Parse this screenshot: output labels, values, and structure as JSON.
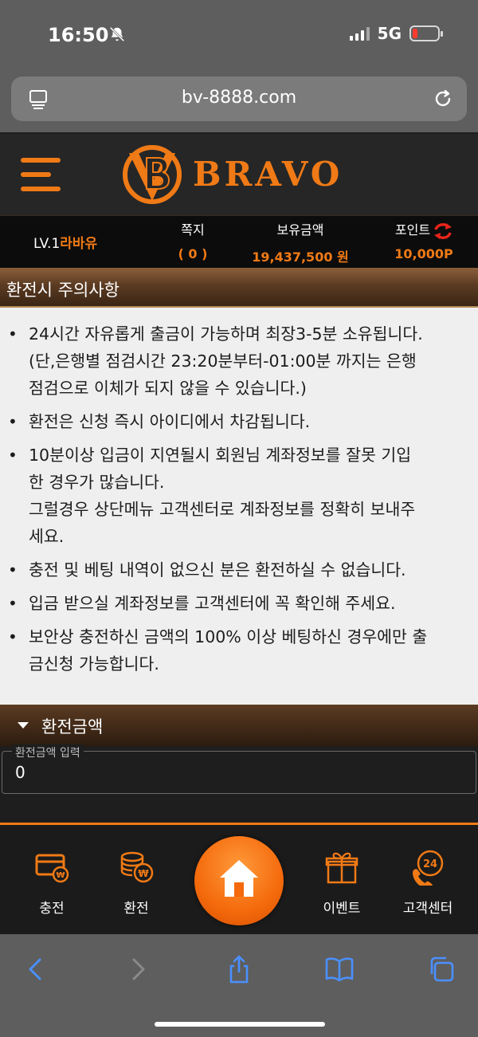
{
  "status_bar": {
    "time": "16:50",
    "network": "5G"
  },
  "browser": {
    "url": "bv-8888.com"
  },
  "site": {
    "logo_text": "BRAVO"
  },
  "user_bar": {
    "level": "LV.1",
    "username": "라바유",
    "notes_label": "쪽지",
    "notes_value": "( 0 )",
    "balance_label": "보유금액",
    "balance_value": "19,437,500 원",
    "points_label": "포인트",
    "points_value": "10,000P"
  },
  "notice": {
    "title": "환전시 주의사항",
    "items": [
      "24시간 자유롭게 출금이 가능하며 최장3-5분 소유됩니다.\n(단,은행별 점검시간 23:20분부터-01:00분 까지는 은행\n점검으로 이체가 되지 않을 수 있습니다.)",
      "환전은 신청 즉시 아이디에서 차감됩니다.",
      "10분이상 입금이 지연될시 회원님 계좌정보를 잘못 기입\n한 경우가 많습니다.\n그럴경우 상단메뉴 고객센터로 계좌정보를 정확히 보내주\n세요.",
      "충전 및 베팅 내역이 없으신 분은 환전하실 수 없습니다.",
      "입금 받으실 계좌정보를 고객센터에 꼭 확인해 주세요.",
      "보안상 충전하신 금액의 100% 이상 베팅하신 경우에만 출\n금신청 가능합니다."
    ]
  },
  "exchange": {
    "section_title": "환전금액",
    "input_label": "환전금액 입력",
    "input_value": "0"
  },
  "bottom_nav": {
    "charge": "충전",
    "exchange": "환전",
    "event": "이벤트",
    "support": "고객센터",
    "support_badge": "24"
  },
  "colors": {
    "accent": "#f07a16",
    "header_brown": "#5b3b22",
    "notice_bg": "#efefef"
  }
}
